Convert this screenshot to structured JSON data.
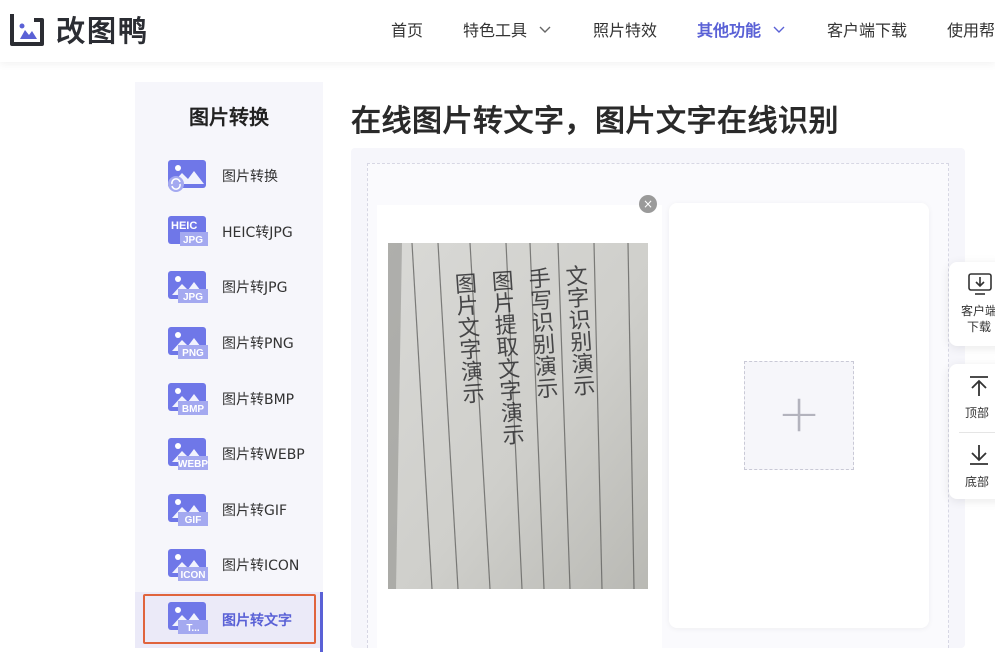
{
  "brand": {
    "name": "改图鸭",
    "accent": "#5a61d6"
  },
  "nav": [
    {
      "label": "首页",
      "has_dropdown": false,
      "active": false
    },
    {
      "label": "特色工具",
      "has_dropdown": true,
      "active": false
    },
    {
      "label": "照片特效",
      "has_dropdown": false,
      "active": false
    },
    {
      "label": "其他功能",
      "has_dropdown": true,
      "active": true
    },
    {
      "label": "客户端下载",
      "has_dropdown": false,
      "active": false
    },
    {
      "label": "使用帮",
      "has_dropdown": false,
      "active": false
    }
  ],
  "sidebar": {
    "title": "图片转换",
    "items": [
      {
        "label": "图片转换",
        "badge": "",
        "icon": "convert-image-icon",
        "active": false
      },
      {
        "label": "HEIC转JPG",
        "badge": "HEIC JPG",
        "icon": "heic-jpg-icon",
        "active": false
      },
      {
        "label": "图片转JPG",
        "badge": "JPG",
        "icon": "jpg-format-icon",
        "active": false
      },
      {
        "label": "图片转PNG",
        "badge": "PNG",
        "icon": "png-format-icon",
        "active": false
      },
      {
        "label": "图片转BMP",
        "badge": "BMP",
        "icon": "bmp-format-icon",
        "active": false
      },
      {
        "label": "图片转WEBP",
        "badge": "WEBP",
        "icon": "webp-format-icon",
        "active": false
      },
      {
        "label": "图片转GIF",
        "badge": "GIF",
        "icon": "gif-format-icon",
        "active": false
      },
      {
        "label": "图片转ICON",
        "badge": "ICON",
        "icon": "icon-format-icon",
        "active": false
      },
      {
        "label": "图片转文字",
        "badge": "T...",
        "icon": "text-format-icon",
        "active": true
      }
    ]
  },
  "main": {
    "title": "在线图片转文字，图片文字在线识别",
    "uploaded_photo": {
      "handwriting": [
        "文字识别演示",
        "手写识别演示",
        "图片提取文字演示",
        "图片文字演示"
      ]
    },
    "close_symbol": "×",
    "add_symbol": "+"
  },
  "float_panel": {
    "download": {
      "label_line1": "客户端",
      "label_line2": "下载",
      "icon": "download-icon"
    },
    "top": {
      "label": "顶部",
      "icon": "arrow-up-icon"
    },
    "bottom": {
      "label": "底部",
      "icon": "arrow-down-icon"
    }
  }
}
